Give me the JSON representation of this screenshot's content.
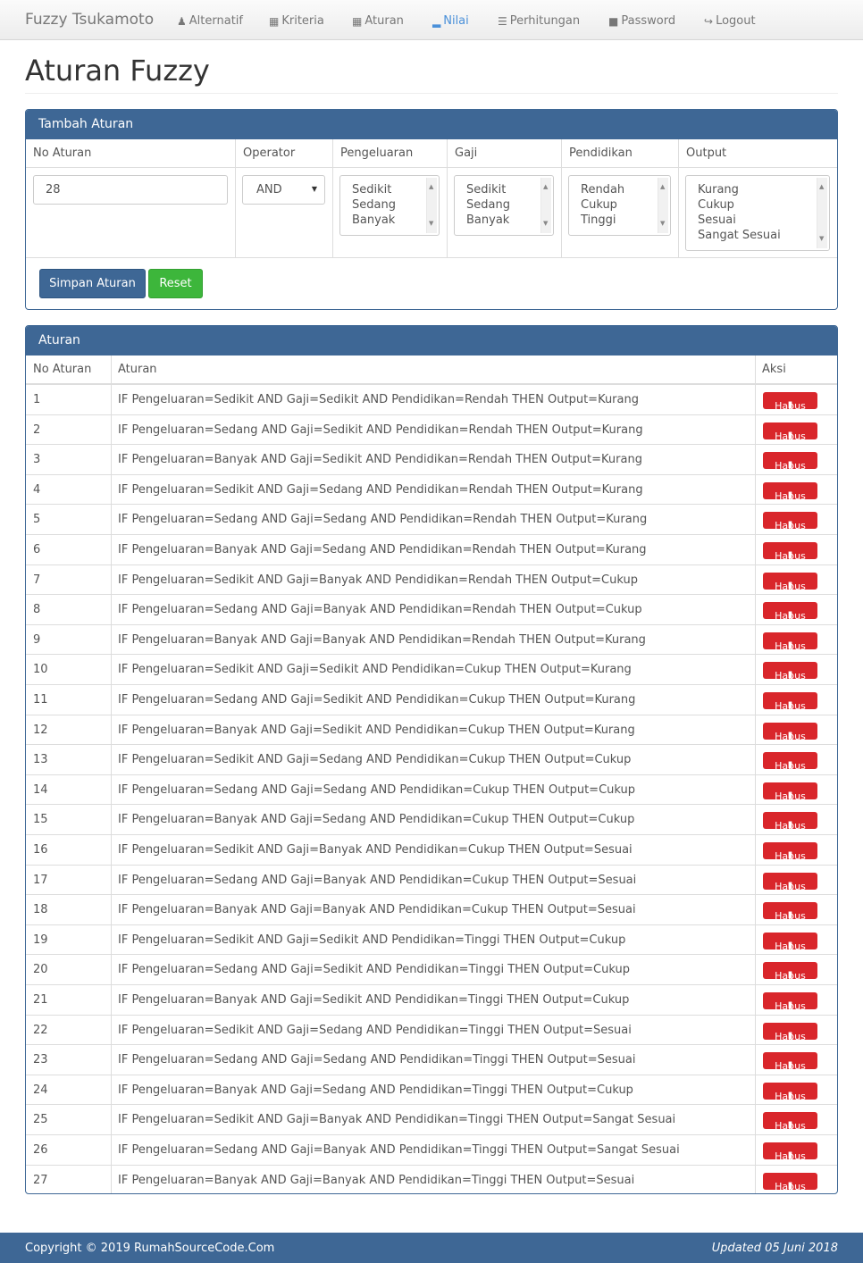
{
  "navbar": {
    "brand": "Fuzzy Tsukamoto",
    "items": [
      {
        "label": "Alternatif",
        "icon": "user-icon"
      },
      {
        "label": "Kriteria",
        "icon": "th-large-icon"
      },
      {
        "label": "Aturan",
        "icon": "th-icon"
      },
      {
        "label": "Nilai",
        "icon": "signal-icon"
      },
      {
        "label": "Perhitungan",
        "icon": "list-icon"
      },
      {
        "label": "Password",
        "icon": "lock-icon"
      },
      {
        "label": "Logout",
        "icon": "log-out-icon"
      }
    ],
    "active": "Nilai"
  },
  "page_title": "Aturan Fuzzy",
  "form": {
    "heading": "Tambah Aturan",
    "columns": [
      "No Aturan",
      "Operator",
      "Pengeluaran",
      "Gaji",
      "Pendidikan",
      "Output"
    ],
    "no_aturan_value": "28",
    "operator_value": "AND",
    "pengeluaran_options": [
      "Sedikit",
      "Sedang",
      "Banyak"
    ],
    "gaji_options": [
      "Sedikit",
      "Sedang",
      "Banyak"
    ],
    "pendidikan_options": [
      "Rendah",
      "Cukup",
      "Tinggi"
    ],
    "output_options": [
      "Kurang",
      "Cukup",
      "Sesuai",
      "Sangat Sesuai"
    ],
    "save_label": "Simpan Aturan",
    "reset_label": "Reset",
    "colors": {
      "primary": "#3e6795",
      "success": "#3db63b"
    }
  },
  "rules_table": {
    "heading": "Aturan",
    "columns": [
      "No Aturan",
      "Aturan",
      "Aksi"
    ],
    "delete_label": "Hapus",
    "delete_color": "#d9262b",
    "rows": [
      {
        "no": "1",
        "rule": "IF Pengeluaran=Sedikit AND Gaji=Sedikit AND Pendidikan=Rendah THEN Output=Kurang"
      },
      {
        "no": "2",
        "rule": "IF Pengeluaran=Sedang AND Gaji=Sedikit AND Pendidikan=Rendah THEN Output=Kurang"
      },
      {
        "no": "3",
        "rule": "IF Pengeluaran=Banyak AND Gaji=Sedikit AND Pendidikan=Rendah THEN Output=Kurang"
      },
      {
        "no": "4",
        "rule": "IF Pengeluaran=Sedikit AND Gaji=Sedang AND Pendidikan=Rendah THEN Output=Kurang"
      },
      {
        "no": "5",
        "rule": "IF Pengeluaran=Sedang AND Gaji=Sedang AND Pendidikan=Rendah THEN Output=Kurang"
      },
      {
        "no": "6",
        "rule": "IF Pengeluaran=Banyak AND Gaji=Sedang AND Pendidikan=Rendah THEN Output=Kurang"
      },
      {
        "no": "7",
        "rule": "IF Pengeluaran=Sedikit AND Gaji=Banyak AND Pendidikan=Rendah THEN Output=Cukup"
      },
      {
        "no": "8",
        "rule": "IF Pengeluaran=Sedang AND Gaji=Banyak AND Pendidikan=Rendah THEN Output=Cukup"
      },
      {
        "no": "9",
        "rule": "IF Pengeluaran=Banyak AND Gaji=Banyak AND Pendidikan=Rendah THEN Output=Kurang"
      },
      {
        "no": "10",
        "rule": "IF Pengeluaran=Sedikit AND Gaji=Sedikit AND Pendidikan=Cukup THEN Output=Kurang"
      },
      {
        "no": "11",
        "rule": "IF Pengeluaran=Sedang AND Gaji=Sedikit AND Pendidikan=Cukup THEN Output=Kurang"
      },
      {
        "no": "12",
        "rule": "IF Pengeluaran=Banyak AND Gaji=Sedikit AND Pendidikan=Cukup THEN Output=Kurang"
      },
      {
        "no": "13",
        "rule": "IF Pengeluaran=Sedikit AND Gaji=Sedang AND Pendidikan=Cukup THEN Output=Cukup"
      },
      {
        "no": "14",
        "rule": "IF Pengeluaran=Sedang AND Gaji=Sedang AND Pendidikan=Cukup THEN Output=Cukup"
      },
      {
        "no": "15",
        "rule": "IF Pengeluaran=Banyak AND Gaji=Sedang AND Pendidikan=Cukup THEN Output=Cukup"
      },
      {
        "no": "16",
        "rule": "IF Pengeluaran=Sedikit AND Gaji=Banyak AND Pendidikan=Cukup THEN Output=Sesuai"
      },
      {
        "no": "17",
        "rule": "IF Pengeluaran=Sedang AND Gaji=Banyak AND Pendidikan=Cukup THEN Output=Sesuai"
      },
      {
        "no": "18",
        "rule": "IF Pengeluaran=Banyak AND Gaji=Banyak AND Pendidikan=Cukup THEN Output=Sesuai"
      },
      {
        "no": "19",
        "rule": "IF Pengeluaran=Sedikit AND Gaji=Sedikit AND Pendidikan=Tinggi THEN Output=Cukup"
      },
      {
        "no": "20",
        "rule": "IF Pengeluaran=Sedang AND Gaji=Sedikit AND Pendidikan=Tinggi THEN Output=Cukup"
      },
      {
        "no": "21",
        "rule": "IF Pengeluaran=Banyak AND Gaji=Sedikit AND Pendidikan=Tinggi THEN Output=Cukup"
      },
      {
        "no": "22",
        "rule": "IF Pengeluaran=Sedikit AND Gaji=Sedang AND Pendidikan=Tinggi THEN Output=Sesuai"
      },
      {
        "no": "23",
        "rule": "IF Pengeluaran=Sedang AND Gaji=Sedang AND Pendidikan=Tinggi THEN Output=Sesuai"
      },
      {
        "no": "24",
        "rule": "IF Pengeluaran=Banyak AND Gaji=Sedang AND Pendidikan=Tinggi THEN Output=Cukup"
      },
      {
        "no": "25",
        "rule": "IF Pengeluaran=Sedikit AND Gaji=Banyak AND Pendidikan=Tinggi THEN Output=Sangat Sesuai"
      },
      {
        "no": "26",
        "rule": "IF Pengeluaran=Sedang AND Gaji=Banyak AND Pendidikan=Tinggi THEN Output=Sangat Sesuai"
      },
      {
        "no": "27",
        "rule": "IF Pengeluaran=Banyak AND Gaji=Banyak AND Pendidikan=Tinggi THEN Output=Sesuai"
      }
    ]
  },
  "footer": {
    "copyright": "Copyright © 2019 RumahSourceCode.Com",
    "updated": "Updated 05 Juni 2018"
  }
}
